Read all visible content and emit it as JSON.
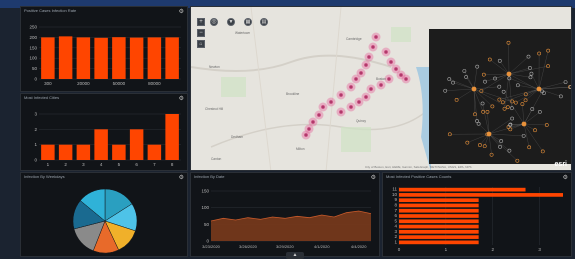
{
  "colors": {
    "accent": "#ff4500",
    "panel_bg": "#111418",
    "area": "#7a3a1c"
  },
  "panels": {
    "p1": {
      "title": "Positive Cases Infection Rate"
    },
    "p2": {
      "title": "Most Infected Cities"
    },
    "p3": {
      "title": "Infection By Weekdays"
    },
    "p4": {
      "title": "Infection By Date"
    },
    "p5": {
      "title": "Most Infected Positive Cases Counts"
    }
  },
  "map": {
    "labels": [
      "Watertown",
      "Cambridge",
      "Newton",
      "Brookline",
      "Boston",
      "Chestnut Hill",
      "Dedham",
      "Canton",
      "Milton",
      "Quincy"
    ],
    "attribution": "City of Boston, Esri, HERE, Garmin, SafeGraph, METI/NASA, USGS, EPA, NPS",
    "esri": "esri"
  },
  "toolbar": {
    "icons": [
      "plus-icon",
      "minus-icon",
      "home-icon",
      "layers-icon",
      "filter-icon",
      "table-icon",
      "print-icon"
    ]
  },
  "chart_data": [
    {
      "type": "bar",
      "title": "Positive Cases Infection Rate",
      "categories": [
        "300",
        "",
        "20000",
        "",
        "50000",
        "",
        "80000",
        ""
      ],
      "values": [
        200,
        205,
        200,
        198,
        201,
        199,
        200,
        200
      ],
      "ylim": [
        0,
        250
      ],
      "yticks": [
        "250",
        "200",
        "150",
        "100",
        "50",
        "0"
      ],
      "grid": true
    },
    {
      "type": "bar",
      "title": "Most Infected Cities",
      "categories": [
        "1",
        "2",
        "3",
        "4",
        "5",
        "6",
        "7",
        "8"
      ],
      "values": [
        1,
        1,
        1,
        2,
        1,
        2,
        1,
        3
      ],
      "ylim": [
        0,
        3
      ],
      "yticks": [
        "3",
        "2",
        "1",
        "0"
      ],
      "grid": true
    },
    {
      "type": "pie",
      "title": "Infection By Weekdays",
      "values": [
        16,
        14,
        13,
        13,
        15,
        15,
        14
      ],
      "colors": [
        "#2a9fc0",
        "#4ec3e8",
        "#f0b02a",
        "#e86a2a",
        "#8a8a8a",
        "#1a6a90",
        "#2fb2d8"
      ]
    },
    {
      "type": "area",
      "title": "Infection By Date",
      "x": [
        "3/23/2020",
        "",
        "",
        "3/26/2020",
        "",
        "",
        "3/29/2020",
        "",
        "",
        "4/1/2020",
        "",
        "",
        "4/4/2020",
        ""
      ],
      "values": [
        60,
        68,
        63,
        70,
        65,
        72,
        68,
        74,
        70,
        78,
        72,
        85,
        90,
        82
      ],
      "ylim": [
        0,
        150
      ],
      "yticks": [
        "150",
        "100",
        "50",
        "0"
      ]
    },
    {
      "type": "bar",
      "title": "Most Infected Positive Cases Counts",
      "categories": [
        "11",
        "10",
        "9",
        "8",
        "7",
        "6",
        "5",
        "4",
        "3",
        "2",
        "1"
      ],
      "values": [
        2.7,
        3.5,
        1.7,
        1.7,
        1.7,
        1.7,
        1.7,
        1.7,
        1.7,
        1.7,
        1.7
      ],
      "xlim": [
        0,
        3.5
      ],
      "xticks": [
        "0",
        "1",
        "2",
        "3"
      ],
      "orientation": "horizontal"
    }
  ]
}
